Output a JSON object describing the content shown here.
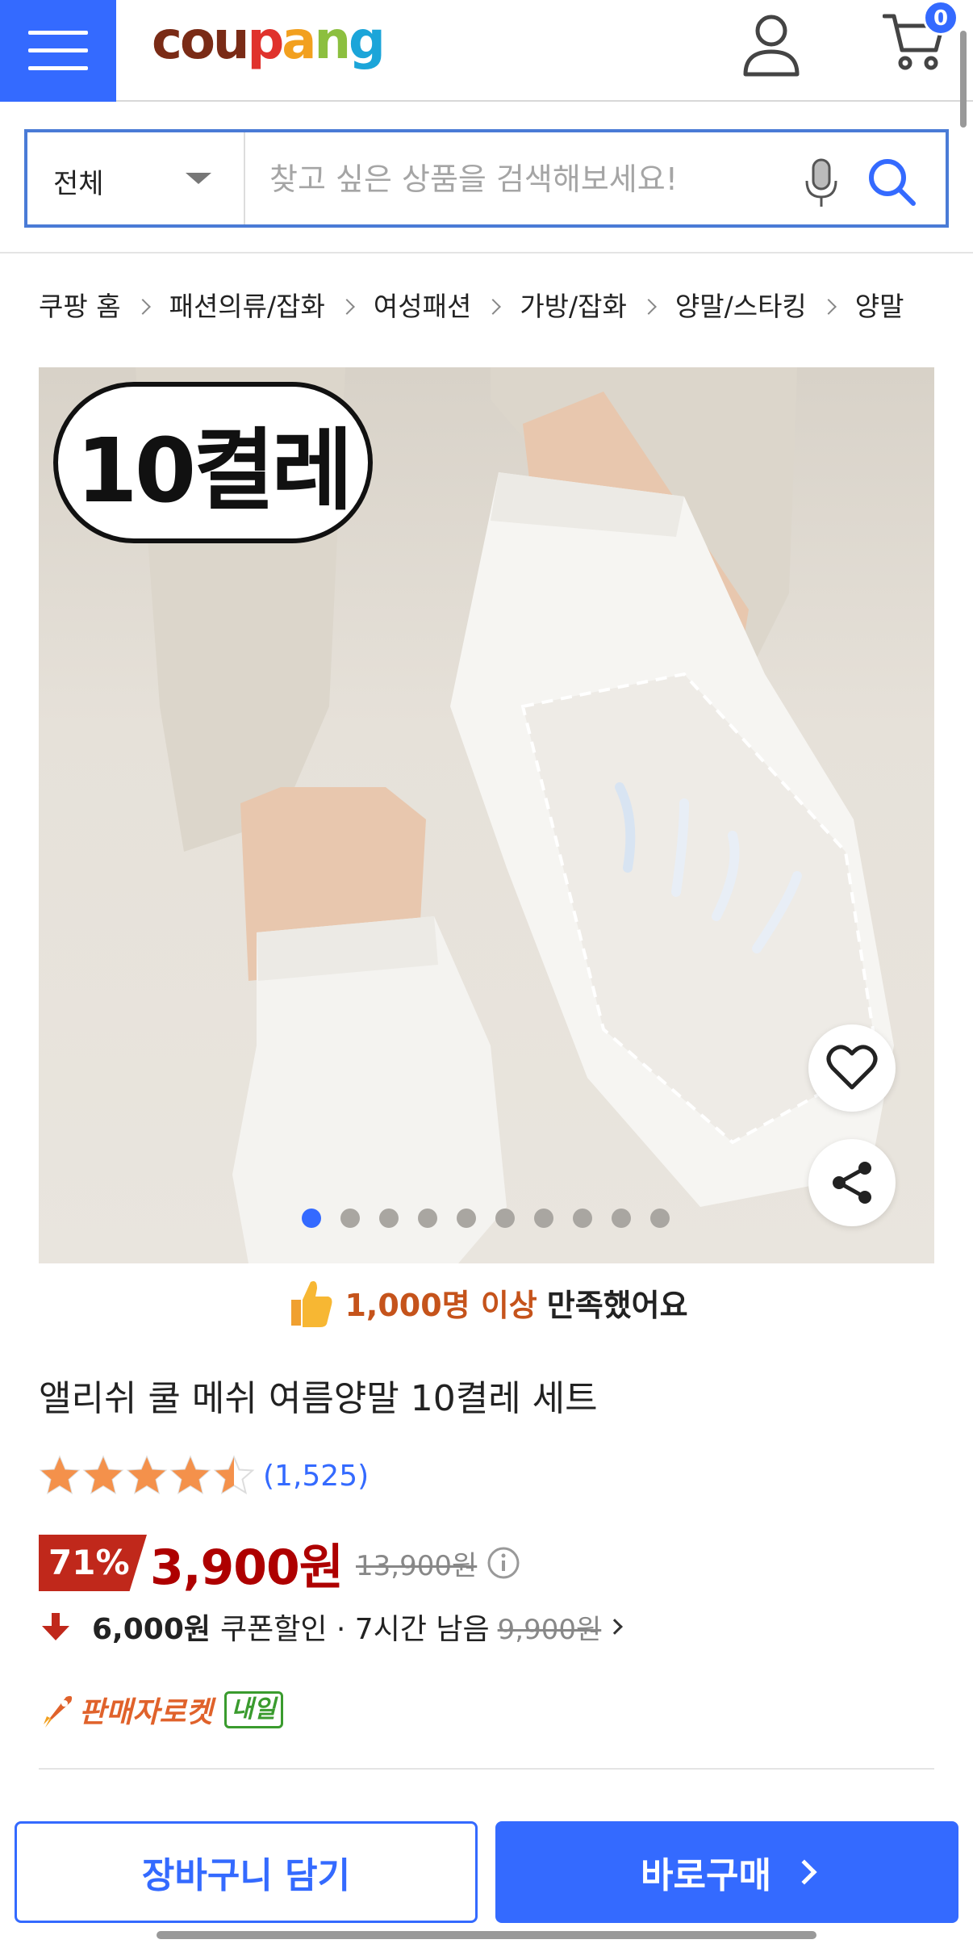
{
  "header": {
    "logo_text": [
      "c",
      "o",
      "u",
      "p",
      "a",
      "n",
      "g"
    ],
    "cart_count": "0"
  },
  "search": {
    "category": "전체",
    "placeholder": "찾고 싶은 상품을 검색해보세요!"
  },
  "breadcrumb": [
    "쿠팡 홈",
    "패션의류/잡화",
    "여성패션",
    "가방/잡화",
    "양말/스타킹",
    "양말"
  ],
  "product_image": {
    "badge_text": "10켤레",
    "dot_count": 10,
    "active_dot": 0
  },
  "satisfaction": {
    "highlight": "1,000명 이상",
    "text": "만족했어요"
  },
  "product": {
    "title": "앨리쉬 쿨 메쉬 여름양말 10켤레 세트",
    "rating": 4.5,
    "review_count": "(1,525)"
  },
  "price": {
    "discount": "71%",
    "sale_price": "3,900원",
    "original_price": "13,900원"
  },
  "coupon": {
    "amount": "6,000원",
    "text": "쿠폰할인 · 7시간 남음",
    "price_before": "9,900원"
  },
  "delivery": {
    "rocket_label": "판매자로켓",
    "tomorrow_badge": "내일"
  },
  "actions": {
    "add_to_cart": "장바구니 담기",
    "buy_now": "바로구매"
  },
  "colors": {
    "brand_blue": "#346aff",
    "sale_red": "#ae0000",
    "badge_red": "#c0281b",
    "highlight_orange": "#c5531b",
    "rocket_orange": "#e0622b",
    "star_orange": "#f4914b",
    "tomorrow_green": "#3a9b2e"
  }
}
